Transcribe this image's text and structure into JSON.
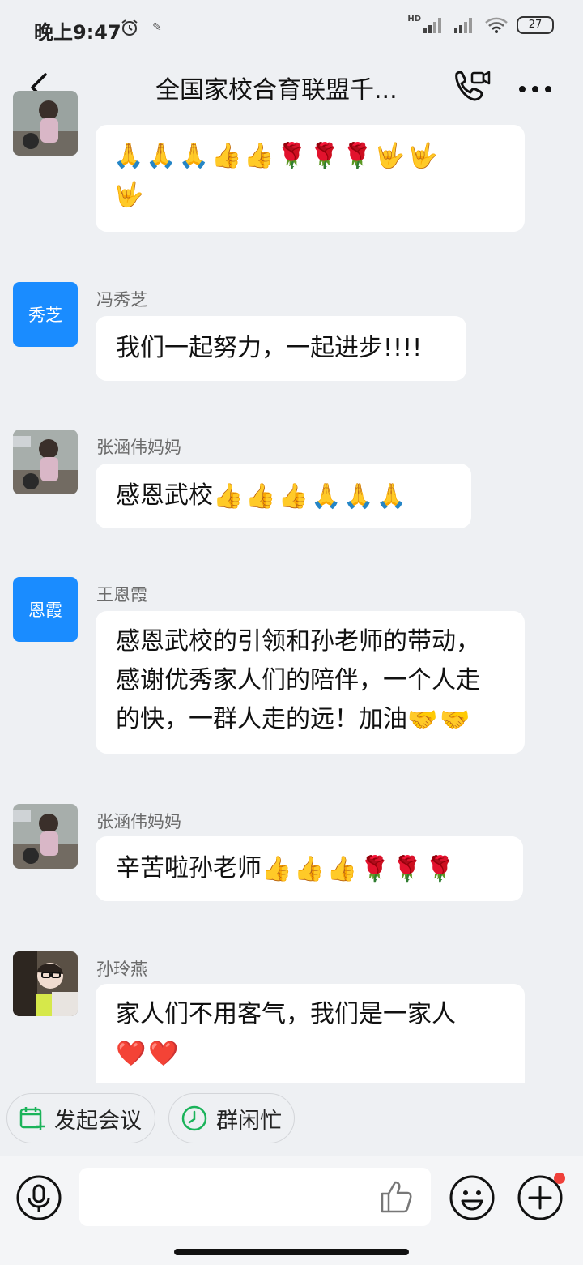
{
  "status_bar": {
    "time": "晚上9:47",
    "network": "HD",
    "battery": "27"
  },
  "header": {
    "title": "全国家校合育联盟千..."
  },
  "messages": [
    {
      "sender": "",
      "avatar": "photo-girl",
      "content": "",
      "emojis_line1": "🙏🙏🙏👍👍🌹🌹🌹🤟🤟",
      "emojis_line2": "🤟"
    },
    {
      "sender": "冯秀芝",
      "avatar_text": "秀芝",
      "content": "我们一起努力，一起进步!!!!"
    },
    {
      "sender": "张涵伟妈妈",
      "avatar": "photo-girl",
      "content": "感恩武校",
      "emojis": "👍👍👍🙏🙏🙏"
    },
    {
      "sender": "王恩霞",
      "avatar_text": "恩霞",
      "line1": "感恩武校的引领和孙老师的带动，",
      "line2": "感谢优秀家人们的陪伴，一个人走",
      "line3": "的快，一群人走的远！加油",
      "emojis": "🤝🤝"
    },
    {
      "sender": "张涵伟妈妈",
      "avatar": "photo-girl",
      "content": "辛苦啦孙老师",
      "emojis": "👍👍👍🌹🌹🌹"
    },
    {
      "sender": "孙玲燕",
      "avatar": "photo-woman",
      "content": "家人们不用客气，我们是一家人",
      "emojis": "❤️❤️"
    }
  ],
  "quick_actions": [
    {
      "label": "发起会议",
      "icon": "calendar-add-icon"
    },
    {
      "label": "群闲忙",
      "icon": "clock-icon"
    }
  ],
  "colors": {
    "accent": "#1a8cff",
    "background": "#eef0f3",
    "bubble": "#ffffff",
    "green_icon": "#1bb35a",
    "red_dot": "#f0403a"
  }
}
